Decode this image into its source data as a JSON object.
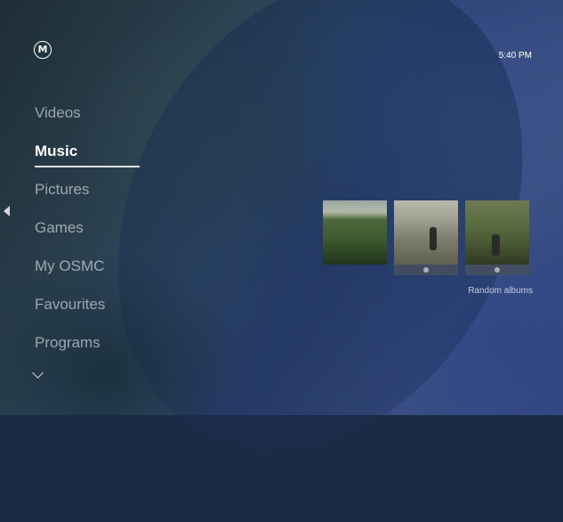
{
  "app": {
    "logo_text": "M",
    "clock": "5:40 PM"
  },
  "menu": {
    "items": [
      {
        "label": "Videos",
        "active": false
      },
      {
        "label": "Music",
        "active": true
      },
      {
        "label": "Pictures",
        "active": false
      },
      {
        "label": "Games",
        "active": false
      },
      {
        "label": "My OSMC",
        "active": false
      },
      {
        "label": "Favourites",
        "active": false
      },
      {
        "label": "Programs",
        "active": false
      }
    ]
  },
  "widget": {
    "caption": "Random albums",
    "albums_count": 3
  }
}
